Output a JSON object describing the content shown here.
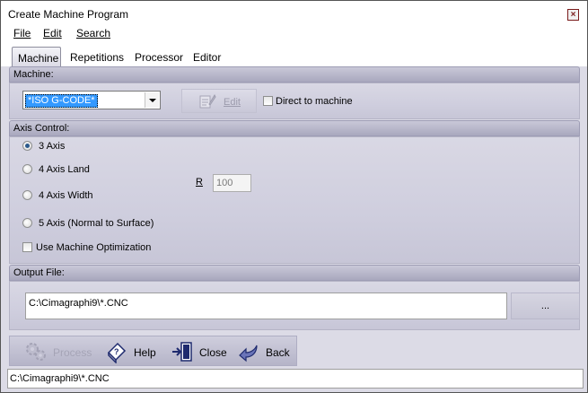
{
  "window": {
    "title": "Create Machine Program"
  },
  "menu": {
    "file": "File",
    "edit": "Edit",
    "search": "Search"
  },
  "tabs": [
    "Machine",
    "Repetitions",
    "Processor",
    "Editor"
  ],
  "machine": {
    "header": "Machine:",
    "selected": "*ISO G-CODE*",
    "edit_label": "Edit",
    "direct_label": "Direct to machine",
    "direct_checked": false
  },
  "axis": {
    "header": "Axis Control:",
    "options": [
      "3 Axis",
      "4 Axis Land",
      "4 Axis Width",
      "5 Axis (Normal to Surface)"
    ],
    "selected_index": 0,
    "r_label": "R",
    "r_value": "100",
    "optimization_label": "Use Machine Optimization",
    "optimization_checked": false
  },
  "output": {
    "header": "Output File:",
    "path": "C:\\Cimagraphi9\\*.CNC",
    "browse_label": "..."
  },
  "toolbar": {
    "process": "Process",
    "help": "Help",
    "close": "Close",
    "back": "Back"
  },
  "status": {
    "text": "C:\\Cimagraphi9\\*.CNC"
  }
}
